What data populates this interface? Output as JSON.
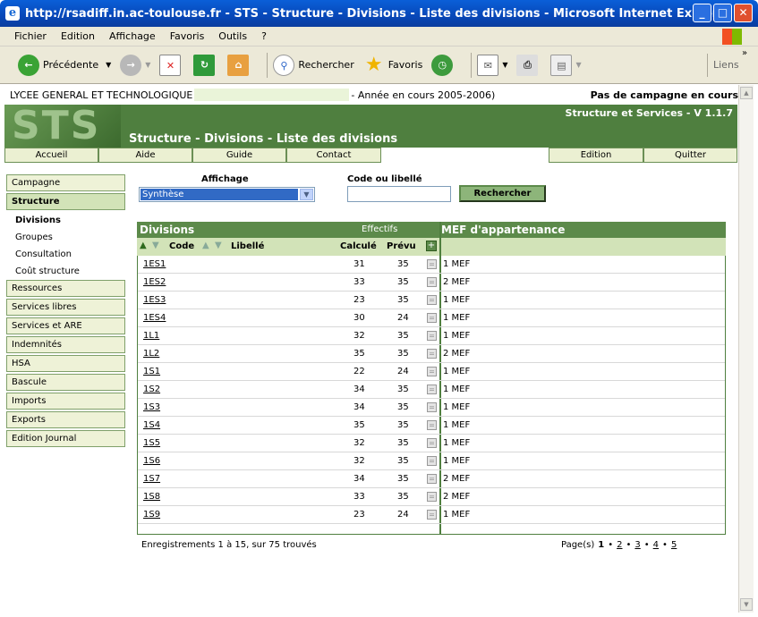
{
  "window": {
    "title": "http://rsadiff.in.ac-toulouse.fr - STS - Structure - Divisions - Liste des divisions - Microsoft Internet Explorer",
    "minimize": "_",
    "maximize": "□",
    "close": "✕"
  },
  "menu": [
    "Fichier",
    "Edition",
    "Affichage",
    "Favoris",
    "Outils",
    "?"
  ],
  "toolbar": {
    "back": "Précédente",
    "search": "Rechercher",
    "favorites": "Favoris",
    "links": "Liens",
    "chevron": "»"
  },
  "page": {
    "school": "LYCEE GENERAL ET TECHNOLOGIQUE",
    "year": "- Année en cours 2005-2006)",
    "campaign": "Pas de campagne en cours",
    "logo": "STS",
    "app_version": "Structure et Services - V 1.1.7",
    "heading": "Structure - Divisions - Liste des divisions"
  },
  "nav": [
    "Accueil",
    "Aide",
    "Guide",
    "Contact",
    "Edition",
    "Quitter"
  ],
  "sidebar": {
    "sections": [
      "Campagne",
      "Structure"
    ],
    "sub": [
      "Divisions",
      "Groupes",
      "Consultation",
      "Coût structure"
    ],
    "rest": [
      "Ressources",
      "Services libres",
      "Services et ARE",
      "Indemnités",
      "HSA",
      "Bascule",
      "Imports",
      "Exports",
      "Edition Journal"
    ]
  },
  "form": {
    "affichage_label": "Affichage",
    "affichage_value": "Synthèse",
    "code_label": "Code ou libellé",
    "search_button": "Rechercher"
  },
  "table": {
    "title": "Divisions",
    "effectifs": "Effectifs",
    "mef_title": "MEF d'appartenance",
    "col_code": "Code",
    "col_libelle": "Libellé",
    "col_calcule": "Calculé",
    "col_prevu": "Prévu",
    "rows": [
      {
        "code": "1ES1",
        "calc": "31",
        "prevu": "35",
        "mef": "1 MEF"
      },
      {
        "code": "1ES2",
        "calc": "33",
        "prevu": "35",
        "mef": "2 MEF"
      },
      {
        "code": "1ES3",
        "calc": "23",
        "prevu": "35",
        "mef": "1 MEF"
      },
      {
        "code": "1ES4",
        "calc": "30",
        "prevu": "24",
        "mef": "1 MEF"
      },
      {
        "code": "1L1",
        "calc": "32",
        "prevu": "35",
        "mef": "1 MEF"
      },
      {
        "code": "1L2",
        "calc": "35",
        "prevu": "35",
        "mef": "2 MEF"
      },
      {
        "code": "1S1",
        "calc": "22",
        "prevu": "24",
        "mef": "1 MEF"
      },
      {
        "code": "1S2",
        "calc": "34",
        "prevu": "35",
        "mef": "1 MEF"
      },
      {
        "code": "1S3",
        "calc": "34",
        "prevu": "35",
        "mef": "1 MEF"
      },
      {
        "code": "1S4",
        "calc": "35",
        "prevu": "35",
        "mef": "1 MEF"
      },
      {
        "code": "1S5",
        "calc": "32",
        "prevu": "35",
        "mef": "1 MEF"
      },
      {
        "code": "1S6",
        "calc": "32",
        "prevu": "35",
        "mef": "1 MEF"
      },
      {
        "code": "1S7",
        "calc": "34",
        "prevu": "35",
        "mef": "2 MEF"
      },
      {
        "code": "1S8",
        "calc": "33",
        "prevu": "35",
        "mef": "2 MEF"
      },
      {
        "code": "1S9",
        "calc": "23",
        "prevu": "24",
        "mef": "1 MEF"
      }
    ]
  },
  "footer": {
    "records": "Enregistrements 1 à 15, sur 75 trouvés",
    "pages_label": "Page(s)",
    "pages": [
      "1",
      "2",
      "3",
      "4",
      "5"
    ]
  }
}
